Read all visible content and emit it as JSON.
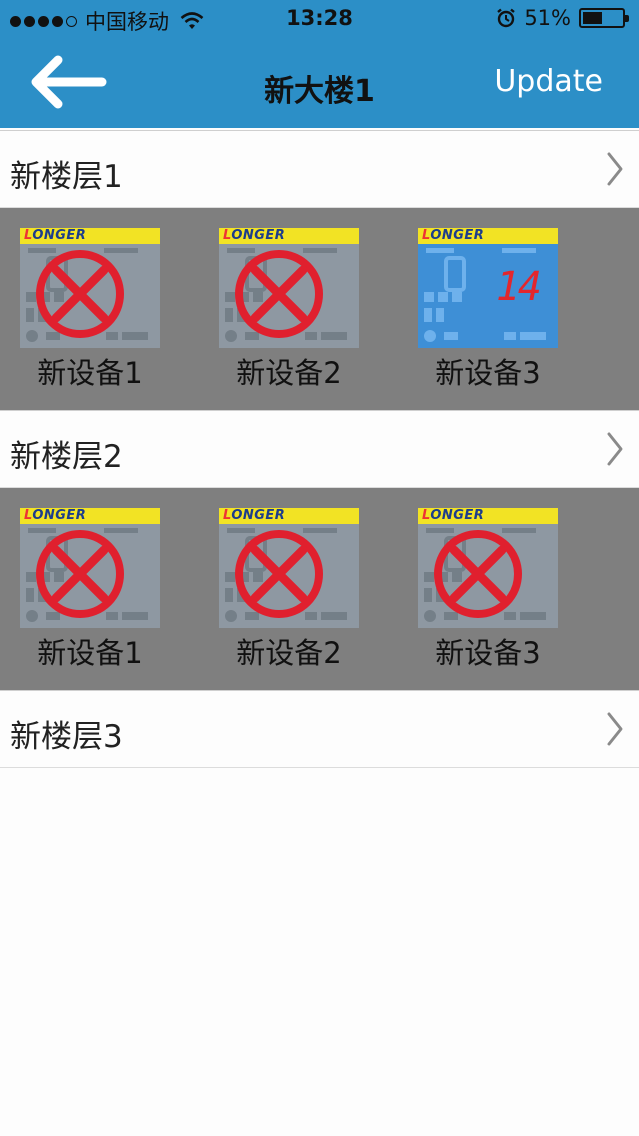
{
  "status_bar": {
    "carrier": "中国移动",
    "time": "13:28",
    "battery_text": "51%",
    "battery_level": 0.51
  },
  "nav": {
    "title": "新大楼1",
    "update_label": "Update",
    "back_icon": "back-arrow-icon"
  },
  "floors": [
    {
      "label": "新楼层1",
      "devices": [
        {
          "name": "新设备1",
          "online": false
        },
        {
          "name": "新设备2",
          "online": false
        },
        {
          "name": "新设备3",
          "online": true,
          "reading": "14"
        }
      ]
    },
    {
      "label": "新楼层2",
      "devices": [
        {
          "name": "新设备1",
          "online": false
        },
        {
          "name": "新设备2",
          "online": false
        },
        {
          "name": "新设备3",
          "online": false
        }
      ]
    },
    {
      "label": "新楼层3",
      "devices": []
    }
  ],
  "device_brand": "LONGER",
  "device_brand_first": "L",
  "device_brand_rest": "ONGER",
  "colors": {
    "header": "#2c8fc7",
    "device_area": "#7f7f7f",
    "offline_mark": "#e0202e",
    "reading": "#e3262d"
  }
}
